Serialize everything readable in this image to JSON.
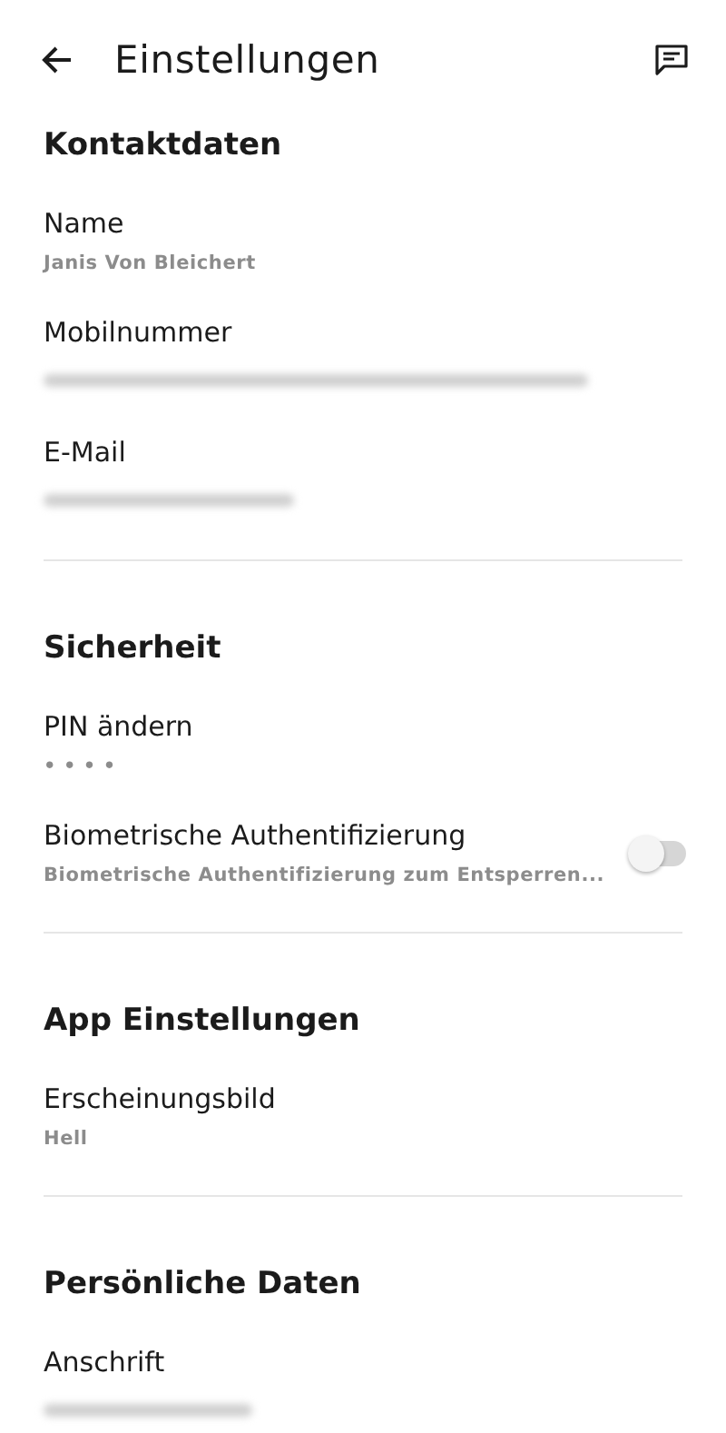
{
  "header": {
    "title": "Einstellungen"
  },
  "sections": [
    {
      "title": "Kontaktdaten",
      "items": [
        {
          "kind": "text",
          "label": "Name",
          "value": "Janis Von Bleichert"
        },
        {
          "kind": "redacted",
          "label": "Mobilnummer"
        },
        {
          "kind": "redacted",
          "label": "E-Mail"
        }
      ]
    },
    {
      "title": "Sicherheit",
      "items": [
        {
          "kind": "text",
          "label": "PIN ändern",
          "value": "• • • •"
        },
        {
          "kind": "toggle",
          "label": "Biometrische Authentifizierung",
          "value": "Biometrische Authentifizierung zum Entsperren...",
          "on": false
        }
      ]
    },
    {
      "title": "App Einstellungen",
      "items": [
        {
          "kind": "text",
          "label": "Erscheinungsbild",
          "value": "Hell"
        }
      ]
    },
    {
      "title": "Persönliche Daten",
      "items": [
        {
          "kind": "redacted",
          "label": "Anschrift"
        }
      ]
    }
  ]
}
